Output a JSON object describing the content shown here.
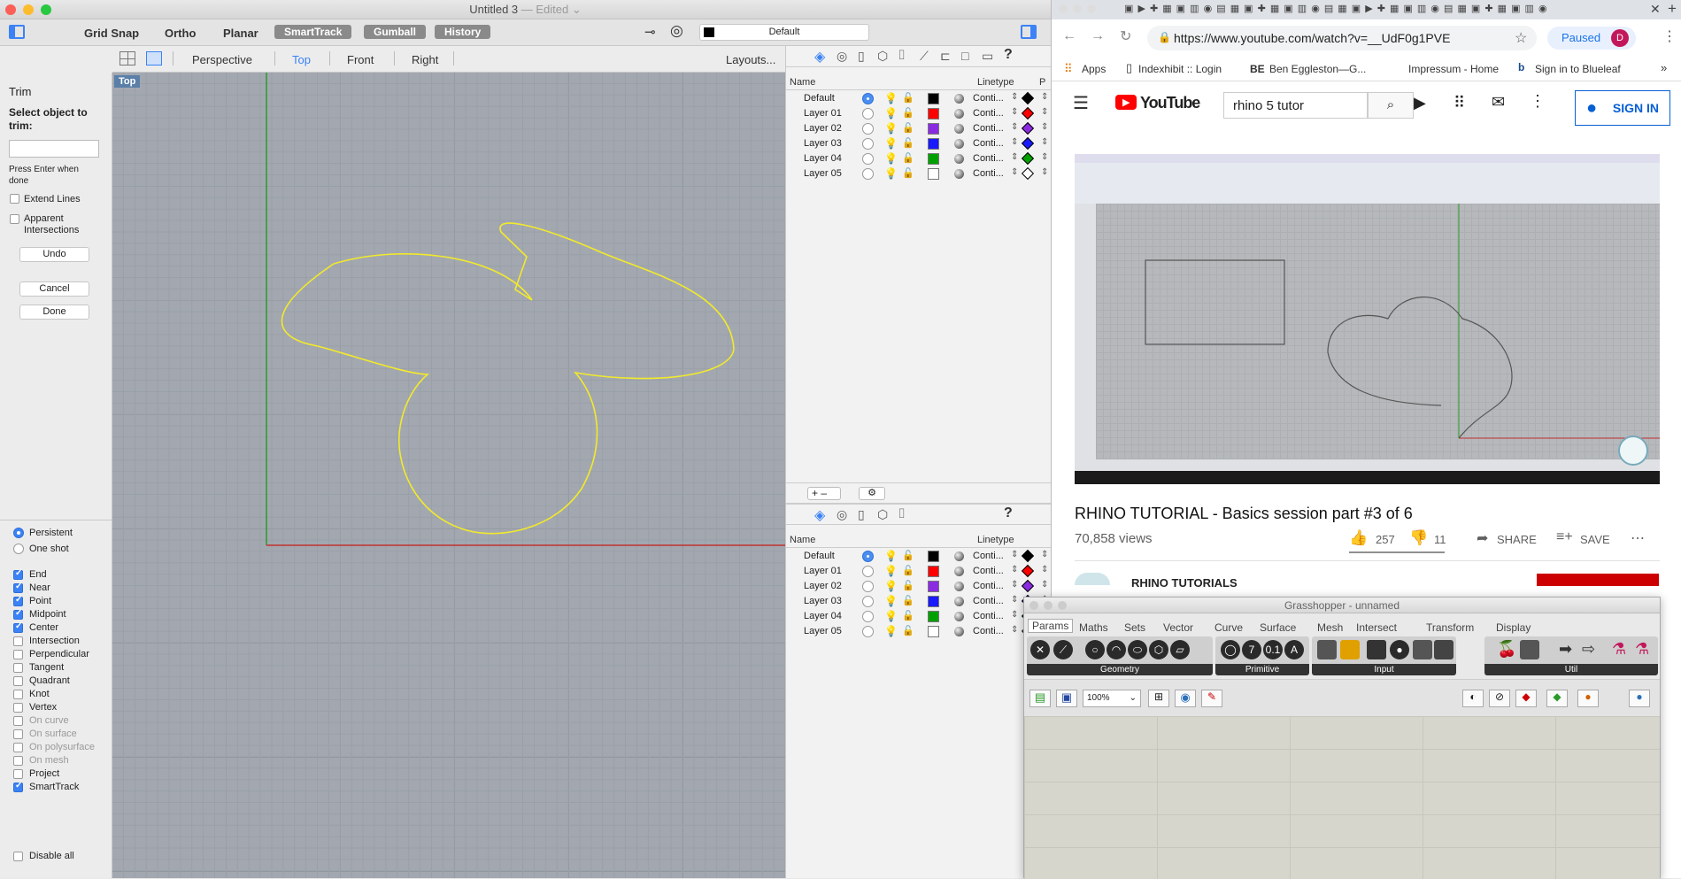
{
  "rhino": {
    "title": "Untitled 3",
    "title_suffix": "— Edited",
    "toolbar": {
      "grid_snap": "Grid Snap",
      "ortho": "Ortho",
      "planar": "Planar",
      "smarttrack": "SmartTrack",
      "gumball": "Gumball",
      "history": "History",
      "layer": "Default"
    },
    "viewtabs": {
      "perspective": "Perspective",
      "top": "Top",
      "front": "Front",
      "right": "Right",
      "layouts": "Layouts..."
    },
    "viewport_label": "Top",
    "command": {
      "name": "Trim",
      "prompt": "Select object to trim:",
      "hint": "Press Enter when done",
      "extend_lines": "Extend Lines",
      "apparent": "Apparent Intersections",
      "undo": "Undo",
      "cancel": "Cancel",
      "done": "Done"
    },
    "osnap": {
      "persistent": "Persistent",
      "one_shot": "One shot",
      "items": [
        {
          "label": "End",
          "on": true
        },
        {
          "label": "Near",
          "on": true
        },
        {
          "label": "Point",
          "on": true
        },
        {
          "label": "Midpoint",
          "on": true
        },
        {
          "label": "Center",
          "on": true
        },
        {
          "label": "Intersection",
          "on": false
        },
        {
          "label": "Perpendicular",
          "on": false
        },
        {
          "label": "Tangent",
          "on": false
        },
        {
          "label": "Quadrant",
          "on": false
        },
        {
          "label": "Knot",
          "on": false
        },
        {
          "label": "Vertex",
          "on": false
        },
        {
          "label": "On curve",
          "on": false,
          "dim": true
        },
        {
          "label": "On surface",
          "on": false,
          "dim": true
        },
        {
          "label": "On polysurface",
          "on": false,
          "dim": true
        },
        {
          "label": "On mesh",
          "on": false,
          "dim": true
        },
        {
          "label": "Project",
          "on": false
        },
        {
          "label": "SmartTrack",
          "on": true
        }
      ],
      "disable_all": "Disable all"
    },
    "layers": {
      "col_name": "Name",
      "col_linetype": "Linetype",
      "col_p": "P",
      "rows": [
        {
          "name": "Default",
          "color": "#000000",
          "lt": "Conti...",
          "cur": true
        },
        {
          "name": "Layer 01",
          "color": "#ff0000",
          "lt": "Conti..."
        },
        {
          "name": "Layer 02",
          "color": "#8a2be2",
          "lt": "Conti..."
        },
        {
          "name": "Layer 03",
          "color": "#1a1aff",
          "lt": "Conti..."
        },
        {
          "name": "Layer 04",
          "color": "#00a000",
          "lt": "Conti..."
        },
        {
          "name": "Layer 05",
          "color": "#ffffff",
          "lt": "Conti..."
        }
      ]
    }
  },
  "chrome": {
    "url": "https://www.youtube.com/watch?v=__UdF0g1PVE",
    "paused": "Paused",
    "avatar": "D",
    "bookmarks": [
      "Apps",
      "Indexhibit :: Login",
      "Ben Eggleston—G...",
      "Impressum - Home",
      "Sign in to Blueleaf"
    ],
    "youtube": {
      "logo": "YouTube",
      "search": "rhino 5 tutor",
      "signin": "SIGN IN",
      "video_title": "RHINO TUTORIAL - Basics session part #3 of 6",
      "views": "70,858 views",
      "likes": "257",
      "dislikes": "11",
      "share": "SHARE",
      "save": "SAVE",
      "channel": "RHINO TUTORIALS"
    }
  },
  "grasshopper": {
    "title": "Grasshopper - unnamed",
    "tabs": [
      "Params",
      "Maths",
      "Sets",
      "Vector",
      "Curve",
      "Surface",
      "Mesh",
      "Intersect",
      "Transform",
      "Display"
    ],
    "groups": [
      "Geometry",
      "Primitive",
      "Input",
      "Util"
    ],
    "zoom": "100%"
  }
}
